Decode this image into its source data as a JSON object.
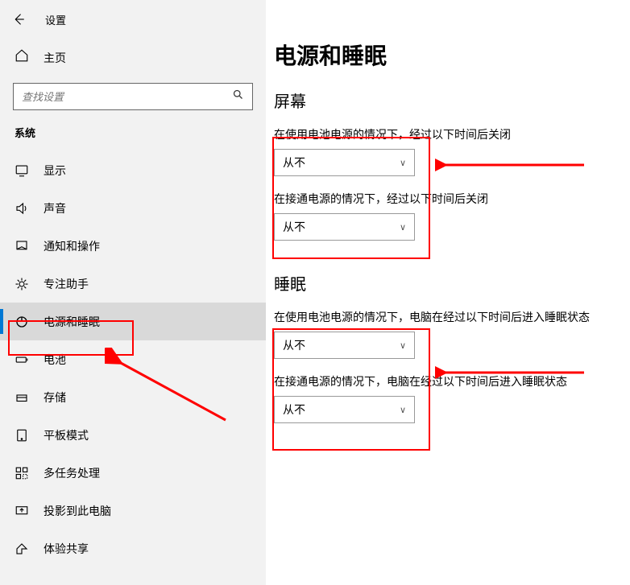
{
  "app_title": "设置",
  "home_label": "主页",
  "search_placeholder": "查找设置",
  "section_header": "系统",
  "nav": [
    {
      "label": "显示",
      "icon": "display"
    },
    {
      "label": "声音",
      "icon": "sound"
    },
    {
      "label": "通知和操作",
      "icon": "notif"
    },
    {
      "label": "专注助手",
      "icon": "focus"
    },
    {
      "label": "电源和睡眠",
      "icon": "power",
      "active": true
    },
    {
      "label": "电池",
      "icon": "battery"
    },
    {
      "label": "存储",
      "icon": "storage"
    },
    {
      "label": "平板模式",
      "icon": "tablet"
    },
    {
      "label": "多任务处理",
      "icon": "multitask"
    },
    {
      "label": "投影到此电脑",
      "icon": "project"
    },
    {
      "label": "体验共享",
      "icon": "share"
    }
  ],
  "page_title": "电源和睡眠",
  "groups": {
    "screen": {
      "heading": "屏幕",
      "battery_label": "在使用电池电源的情况下，经过以下时间后关闭",
      "battery_value": "从不",
      "plugged_label": "在接通电源的情况下，经过以下时间后关闭",
      "plugged_value": "从不"
    },
    "sleep": {
      "heading": "睡眠",
      "battery_label": "在使用电池电源的情况下，电脑在经过以下时间后进入睡眠状态",
      "battery_value": "从不",
      "plugged_label": "在接通电源的情况下，电脑在经过以下时间后进入睡眠状态",
      "plugged_value": "从不"
    }
  },
  "annotations": {
    "color": "#ff0000",
    "boxes": [
      {
        "target": "nav-power"
      },
      {
        "target": "screen-group"
      },
      {
        "target": "sleep-group"
      }
    ],
    "arrows": [
      {
        "from": "right",
        "to": "screen-group"
      },
      {
        "from": "right",
        "to": "sleep-group"
      },
      {
        "from": "screen-group-below",
        "to": "nav-power"
      }
    ]
  }
}
